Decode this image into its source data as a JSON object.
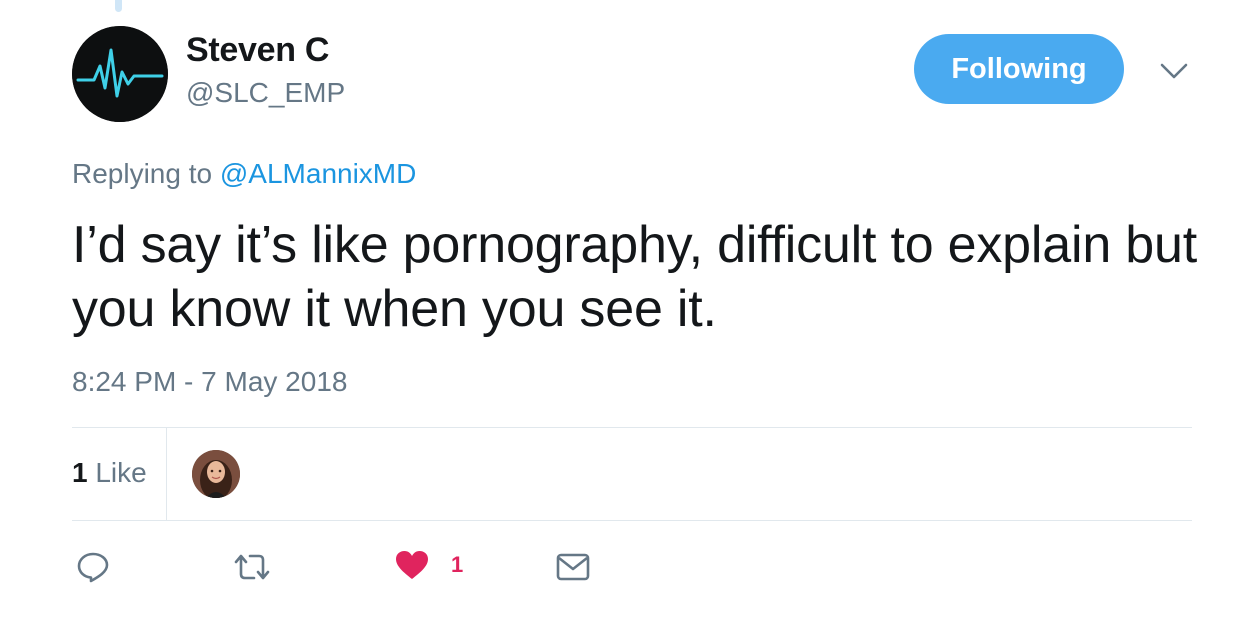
{
  "tweet": {
    "author": {
      "display_name": "Steven C",
      "handle": "@SLC_EMP",
      "avatar": "heartbeat-monitor-avatar"
    },
    "follow_button_label": "Following",
    "menu_icon": "chevron-down-icon",
    "reply_prefix": "Replying to",
    "reply_mention": "@ALMannixMD",
    "text": "I’d say it’s like pornography, difficult to explain but you know it when you see it.",
    "timestamp": "8:24 PM - 7 May 2018"
  },
  "stats": {
    "like_count": "1",
    "like_label": "Like",
    "liker_avatar": "user-photo-avatar"
  },
  "actions": {
    "reply_icon": "reply-icon",
    "retweet_icon": "retweet-icon",
    "like_icon": "heart-icon",
    "like_count": "1",
    "dm_icon": "envelope-icon"
  },
  "colors": {
    "follow_button": "#4aaaf0",
    "mention": "#1b95e0",
    "muted_text": "#657786",
    "like_active": "#e0245e",
    "divider": "#e1e8ed"
  }
}
